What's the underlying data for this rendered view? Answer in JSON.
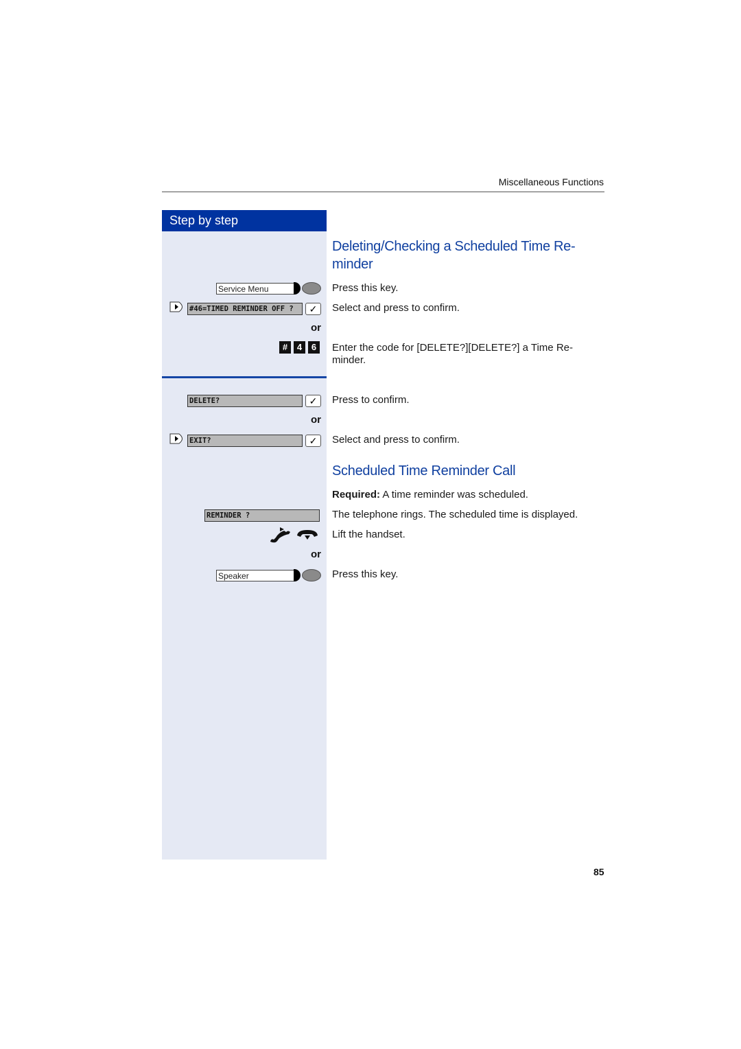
{
  "header": {
    "section_title": "Miscellaneous Functions"
  },
  "sidebar": {
    "title": "Step by step"
  },
  "section1": {
    "heading_line1": "Deleting/Checking a Scheduled Time Re-",
    "heading_line2": "minder",
    "steps": [
      {
        "control": "Service Menu",
        "text": "Press this key."
      },
      {
        "control": "#46=TIMED REMINDER OFF ?",
        "text": "Select and press to confirm."
      },
      {
        "connector": "or"
      },
      {
        "code_keys": [
          "#",
          "4",
          "6"
        ],
        "text_line1": "Enter the code for [DELETE?][DELETE?] a Time Re-",
        "text_line2": "minder."
      },
      {
        "control": "DELETE?",
        "text": "Press to confirm."
      },
      {
        "connector": "or"
      },
      {
        "control": "EXIT?",
        "text": "Select and press to confirm."
      }
    ]
  },
  "section2": {
    "heading": "Scheduled Time Reminder Call",
    "required_label": "Required:",
    "required_text": " A time reminder was scheduled.",
    "steps": [
      {
        "control": "REMINDER ?",
        "text": "The telephone rings.  The scheduled time is displayed."
      },
      {
        "icon": "handset-lift",
        "text": "Lift the handset."
      },
      {
        "connector": "or"
      },
      {
        "control": "Speaker",
        "text": "Press this key."
      }
    ]
  },
  "icons": {
    "nav_arrow": "▶",
    "check": "✓"
  },
  "footer": {
    "page_number": "85"
  }
}
